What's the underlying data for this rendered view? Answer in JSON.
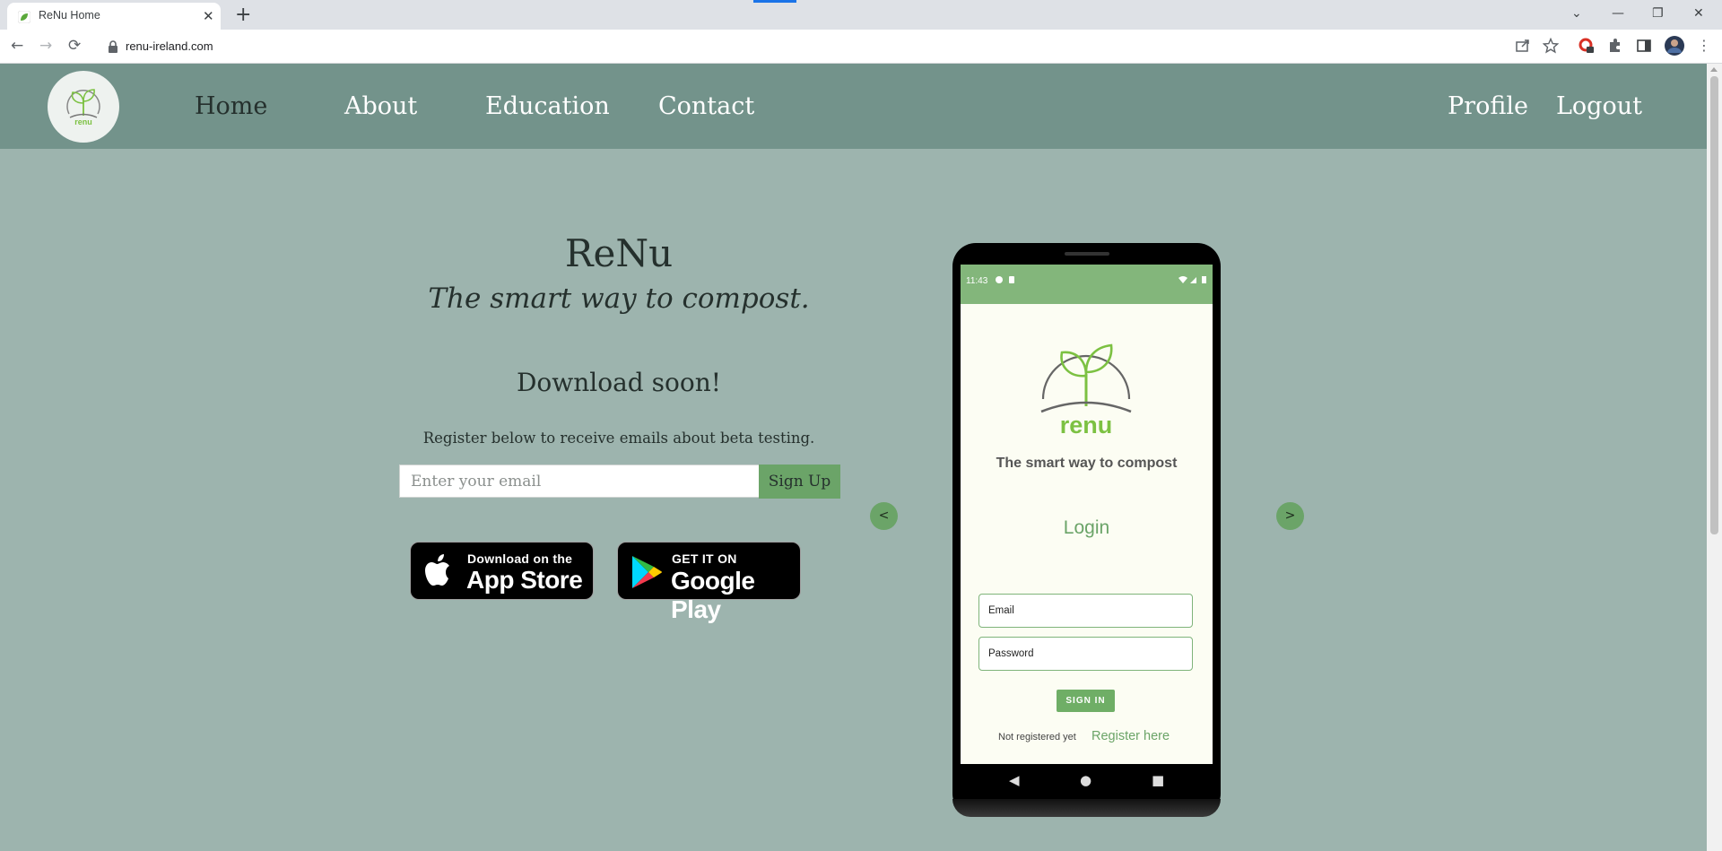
{
  "browser": {
    "tab_title": "ReNu Home",
    "tab_close": "✕",
    "new_tab": "+",
    "url": "renu-ireland.com",
    "window_controls": {
      "tablist": "⌄",
      "minimize": "—",
      "restore": "❐",
      "close": "✕"
    },
    "nav_icons": {
      "back": "←",
      "forward": "→",
      "reload": "⟳"
    }
  },
  "site_nav": {
    "links": [
      "Home",
      "About",
      "Education",
      "Contact"
    ],
    "right_links": [
      "Profile",
      "Logout"
    ],
    "active": "Home"
  },
  "hero": {
    "title": "ReNu",
    "tagline": "The smart way to compost.",
    "download_heading": "Download soon!",
    "register_text": "Register below to receive emails about beta testing.",
    "email_placeholder": "Enter your email",
    "signup_label": "Sign Up"
  },
  "store_badges": {
    "apple": {
      "small": "Download on the",
      "big": "App Store"
    },
    "google": {
      "small": "GET IT ON",
      "big": "Google Play"
    }
  },
  "carousel": {
    "prev": "<",
    "next": ">"
  },
  "phone_screen": {
    "time": "11:43",
    "logo_text": "renu",
    "tagline": "The smart way to compost",
    "login_title": "Login",
    "email_label": "Email",
    "password_label": "Password",
    "signin_label": "SIGN IN",
    "not_registered": "Not registered yet",
    "register_link": "Register here",
    "nav_buttons": [
      "◀",
      "●",
      "■"
    ]
  },
  "colors": {
    "page_background": "#9db4ae",
    "nav_background": "#73938b",
    "accent_green": "#6ba468",
    "status_bar_green": "#83b67b"
  }
}
